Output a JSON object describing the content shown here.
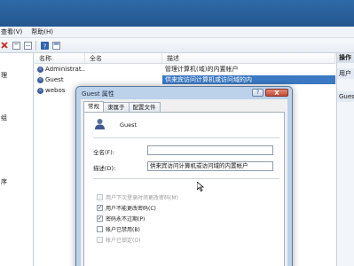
{
  "menubar": {
    "items": [
      "查看(V)",
      "帮助(H)"
    ]
  },
  "tree": {
    "items": [
      "理",
      "",
      "",
      "",
      "组",
      "",
      "",
      "",
      "",
      "",
      "序",
      "",
      "",
      ""
    ]
  },
  "list": {
    "columns": [
      "名称",
      "全名",
      "描述"
    ],
    "rows": [
      {
        "name": "Administrat...",
        "fullname": "",
        "description": "管理计算机(域)的内置帐户",
        "selected": false
      },
      {
        "name": "Guest",
        "fullname": "",
        "description": "供来宾访问计算机或访问域的内",
        "selected": true
      },
      {
        "name": "webos",
        "fullname": "",
        "description": "",
        "selected": false
      }
    ]
  },
  "actions": {
    "header": "操作",
    "group1": "用户",
    "group2": "Guest"
  },
  "dialog": {
    "title": "Guest 属性",
    "help_glyph": "?",
    "close_glyph": "X",
    "tabs": [
      "常规",
      "隶属于",
      "配置文件"
    ],
    "user_name": "Guest",
    "fullname_label": "全名(F):",
    "fullname_value": "",
    "description_label": "描述(D):",
    "description_value": "供来宾访问计算机或访问域的内置帐户",
    "checkboxes": [
      {
        "label": "用户下次登录时须更改密码(M)",
        "checked": false,
        "disabled": true
      },
      {
        "label": "用户不能更改密码(C)",
        "checked": true,
        "disabled": false
      },
      {
        "label": "密码永不过期(P)",
        "checked": true,
        "disabled": false
      },
      {
        "label": "帐户已禁用(B)",
        "checked": false,
        "disabled": false
      },
      {
        "label": "帐户已锁定(O)",
        "checked": false,
        "disabled": true
      }
    ]
  }
}
